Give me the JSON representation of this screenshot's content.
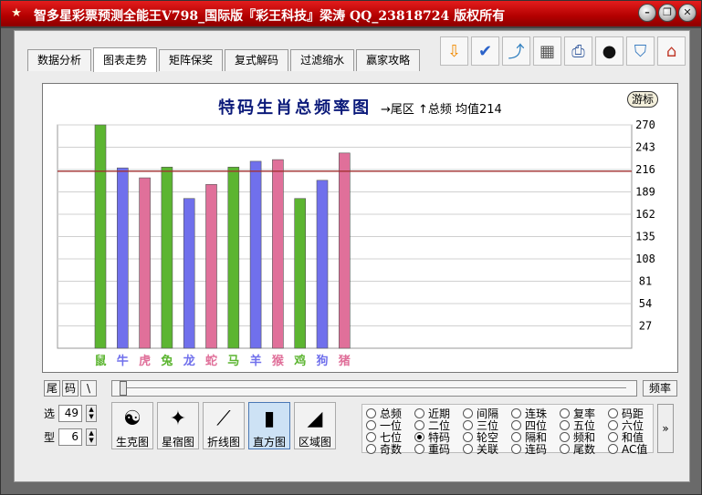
{
  "window": {
    "title": "智多星彩票预测全能王V798_国际版『彩王科技』梁涛 QQ_23818724 版权所有",
    "app_icon_glyph": "★"
  },
  "window_buttons": [
    {
      "name": "minimize-button",
      "glyph": "–"
    },
    {
      "name": "restore-button",
      "glyph": "❐"
    },
    {
      "name": "close-button",
      "glyph": "✕"
    }
  ],
  "tabs": [
    {
      "label": "数据分析",
      "active": false
    },
    {
      "label": "图表走势",
      "active": true
    },
    {
      "label": "矩阵保奖",
      "active": false
    },
    {
      "label": "复式解码",
      "active": false
    },
    {
      "label": "过滤缩水",
      "active": false
    },
    {
      "label": "赢家攻略",
      "active": false
    }
  ],
  "toolbar": [
    {
      "name": "download-arrow-icon",
      "glyph": "⇩",
      "color": "#f08a00"
    },
    {
      "name": "spellcheck-icon",
      "glyph": "✔",
      "color": "#2a62c9"
    },
    {
      "name": "export-icon",
      "glyph": "⤴",
      "color": "#2f7fbf"
    },
    {
      "name": "calculator-icon",
      "glyph": "▦",
      "color": "#555555"
    },
    {
      "name": "printer-icon",
      "glyph": "⎙",
      "color": "#3a5fa0"
    },
    {
      "name": "qq-penguin-icon",
      "glyph": "●",
      "color": "#111111"
    },
    {
      "name": "basket-icon",
      "glyph": "⛉",
      "color": "#3a7cc0"
    },
    {
      "name": "home-icon",
      "glyph": "⌂",
      "color": "#c03a2a"
    }
  ],
  "chart_header": {
    "title": "特码生肖总频率图",
    "subtitle": "→尾区  ↑总频  均值214",
    "game_button": "游标"
  },
  "chart_data": {
    "type": "bar",
    "categories": [
      "鼠",
      "牛",
      "虎",
      "兔",
      "龙",
      "蛇",
      "马",
      "羊",
      "猴",
      "鸡",
      "狗",
      "猪"
    ],
    "values": [
      270,
      218,
      206,
      219,
      181,
      198,
      219,
      226,
      228,
      181,
      203,
      236
    ],
    "colors": [
      "#5cb531",
      "#7070ec",
      "#e0709a",
      "#5cb531",
      "#7070ec",
      "#e0709a",
      "#5cb531",
      "#7070ec",
      "#e0709a",
      "#5cb531",
      "#7070ec",
      "#e0709a"
    ],
    "average": 214,
    "y_ticks": [
      27,
      54,
      81,
      108,
      135,
      162,
      189,
      216,
      243,
      270
    ],
    "ylim": [
      0,
      270
    ],
    "grid": true,
    "average_line_color": "#a33030"
  },
  "slider_row": {
    "btn_tail": "尾",
    "btn_code": "码",
    "btn_slash": "\\",
    "btn_freq": "频率"
  },
  "spinners": {
    "select_label": "选",
    "select_value": "49",
    "type_label": "型",
    "type_value": "6"
  },
  "view_buttons": [
    {
      "label": "生克图",
      "glyph": "☯",
      "active": false
    },
    {
      "label": "星宿图",
      "glyph": "✦",
      "active": false
    },
    {
      "label": "折线图",
      "glyph": "⟋",
      "active": false
    },
    {
      "label": "直方图",
      "glyph": "▮",
      "active": true
    },
    {
      "label": "区域图",
      "glyph": "◢",
      "active": false
    }
  ],
  "radio_options": [
    [
      "总频",
      "近期",
      "间隔",
      "连珠",
      "复率",
      "码距"
    ],
    [
      "一位",
      "二位",
      "三位",
      "四位",
      "五位",
      "六位"
    ],
    [
      "七位",
      "特码",
      "轮空",
      "隔和",
      "频和",
      "和值"
    ],
    [
      "奇数",
      "重码",
      "关联",
      "连码",
      "尾数",
      "AC值"
    ]
  ],
  "radio_selected": "特码",
  "more_button": "»"
}
